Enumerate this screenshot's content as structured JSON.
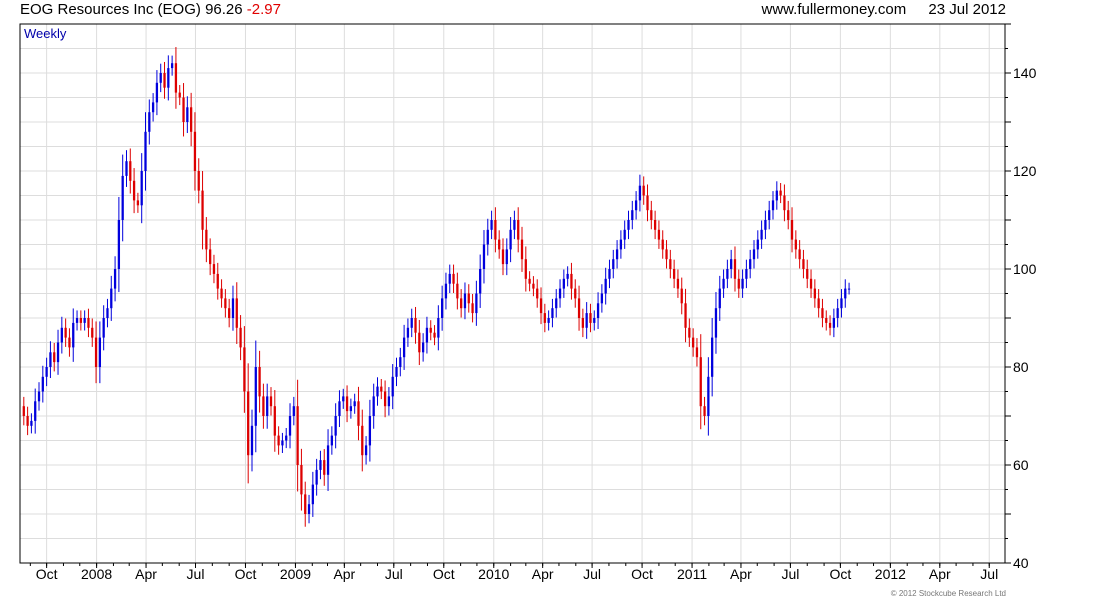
{
  "header": {
    "title": "EOG Resources Inc (EOG)",
    "price": "96.26",
    "change": "-2.97",
    "site": "www.fullermoney.com",
    "date": "23 Jul 2012"
  },
  "footer": {
    "copyright": "© 2012 Stockcube Research Ltd"
  },
  "colors": {
    "up": "#0000dd",
    "down": "#dd0000",
    "grid": "#dddddd",
    "frame": "#000000",
    "label": "#0000aa"
  },
  "chart_data": {
    "type": "candlestick",
    "title": "EOG Resources Inc (EOG)",
    "frequency_label": "Weekly",
    "ylim": [
      40,
      150
    ],
    "yticks": [
      40,
      60,
      80,
      100,
      120,
      140
    ],
    "y_axis_position": "right",
    "xlim": [
      "2007-08-13",
      "2012-07-30"
    ],
    "xticks": [
      {
        "label": "Oct",
        "date": "2007-10-01"
      },
      {
        "label": "2008",
        "date": "2008-01-01"
      },
      {
        "label": "Apr",
        "date": "2008-04-01"
      },
      {
        "label": "Jul",
        "date": "2008-07-01"
      },
      {
        "label": "Oct",
        "date": "2008-10-01"
      },
      {
        "label": "2009",
        "date": "2009-01-01"
      },
      {
        "label": "Apr",
        "date": "2009-04-01"
      },
      {
        "label": "Jul",
        "date": "2009-07-01"
      },
      {
        "label": "Oct",
        "date": "2009-10-01"
      },
      {
        "label": "2010",
        "date": "2010-01-01"
      },
      {
        "label": "Apr",
        "date": "2010-04-01"
      },
      {
        "label": "Jul",
        "date": "2010-07-01"
      },
      {
        "label": "Oct",
        "date": "2010-10-01"
      },
      {
        "label": "2011",
        "date": "2011-01-01"
      },
      {
        "label": "Apr",
        "date": "2011-04-01"
      },
      {
        "label": "Jul",
        "date": "2011-07-01"
      },
      {
        "label": "Oct",
        "date": "2011-10-01"
      },
      {
        "label": "2012",
        "date": "2012-01-01"
      },
      {
        "label": "Apr",
        "date": "2012-04-01"
      },
      {
        "label": "Jul",
        "date": "2012-07-01"
      }
    ],
    "candle_series": {
      "first_week": "2007-08-13",
      "interval_days": 7,
      "closes": [
        72,
        70,
        68,
        69,
        73,
        75,
        78,
        80,
        83,
        81,
        85,
        88,
        86,
        84,
        89,
        90,
        89,
        90,
        88,
        86,
        80,
        86,
        90,
        92,
        96,
        100,
        110,
        119,
        122,
        118,
        114,
        113,
        120,
        128,
        132,
        134,
        138,
        140,
        137,
        141,
        142,
        136,
        135,
        130,
        133,
        128,
        120,
        116,
        108,
        104,
        101,
        99,
        96,
        94,
        92,
        90,
        94,
        88,
        84,
        75,
        62,
        68,
        80,
        74,
        70,
        74,
        72,
        66,
        64,
        65,
        66,
        70,
        72,
        60,
        54,
        50,
        52,
        56,
        59,
        61,
        58,
        64,
        66,
        70,
        73,
        74,
        71,
        72,
        73,
        68,
        62,
        64,
        70,
        74,
        76,
        75,
        72,
        74,
        78,
        80,
        82,
        86,
        88,
        90,
        87,
        83,
        85,
        88,
        87,
        86,
        90,
        94,
        97,
        99,
        97,
        94,
        92,
        95,
        93,
        91,
        95,
        100,
        105,
        108,
        110,
        106,
        104,
        101,
        104,
        108,
        110,
        106,
        102,
        98,
        97,
        96,
        94,
        91,
        89,
        90,
        92,
        94,
        96,
        98,
        99,
        96,
        94,
        90,
        88,
        91,
        89,
        90,
        93,
        95,
        98,
        100,
        102,
        104,
        106,
        108,
        110,
        112,
        114,
        117,
        115,
        112,
        110,
        108,
        106,
        104,
        102,
        100,
        98,
        96,
        93,
        88,
        86,
        84,
        82,
        72,
        70,
        78,
        86,
        92,
        96,
        98,
        100,
        102,
        98,
        96,
        98,
        100,
        102,
        104,
        106,
        108,
        110,
        112,
        114,
        116,
        115,
        112,
        110,
        106,
        104,
        102,
        100,
        98,
        96,
        94,
        92,
        90,
        89,
        88,
        90,
        92,
        94,
        96,
        96
      ]
    },
    "visible_price_range": {
      "low": 45,
      "high": 145
    },
    "grid": true,
    "legend": "none",
    "annotations": [
      {
        "text": "Weekly",
        "position": "top-left"
      }
    ]
  }
}
